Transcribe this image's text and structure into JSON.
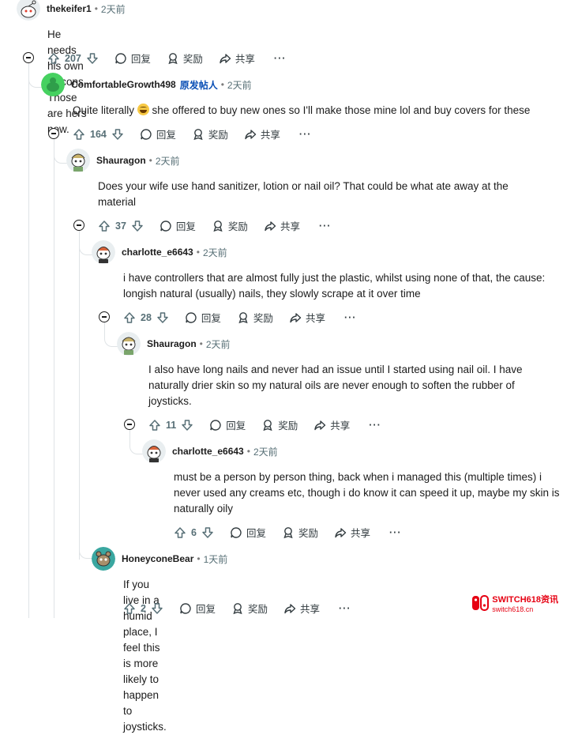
{
  "labels": {
    "reply": "回复",
    "award": "奖励",
    "share": "共享",
    "more": "···"
  },
  "comments": [
    {
      "id": "c1",
      "username": "thekeifer1",
      "time": "2天前",
      "op_badge": "",
      "body": "He needs his own joycons. Those are hers now.",
      "votes": "207",
      "avatar_icon": "snoo-avatar-icon"
    },
    {
      "id": "c2",
      "username": "ComfortableGrowth498",
      "time": "2天前",
      "op_badge": "原发帖人",
      "body_before": "Quite literally ",
      "emoji": "grinning-sweat-emoji",
      "body_after": " she offered to buy new ones so I'll make those mine lol and buy covers for these",
      "votes": "164",
      "avatar_icon": "green-default-avatar-icon"
    },
    {
      "id": "c3",
      "username": "Shauragon",
      "time": "2天前",
      "op_badge": "",
      "body": "Does your wife use hand sanitizer, lotion or nail oil? That could be what ate away at the material",
      "votes": "37",
      "avatar_icon": "snoo-avatar-icon"
    },
    {
      "id": "c4",
      "username": "charlotte_e6643",
      "time": "2天前",
      "op_badge": "",
      "body": "i have controllers that are almost fully just the plastic, whilst using none of that, the cause: longish natural (usually) nails, they slowly scrape at it over time",
      "votes": "28",
      "avatar_icon": "snoo-avatar-icon"
    },
    {
      "id": "c5",
      "username": "Shauragon",
      "time": "2天前",
      "op_badge": "",
      "body": "I also have long nails and never had an issue until I started using nail oil. I have naturally drier skin so my natural oils are never enough to soften the rubber of joysticks.",
      "votes": "11",
      "avatar_icon": "snoo-avatar-icon"
    },
    {
      "id": "c6",
      "username": "charlotte_e6643",
      "time": "2天前",
      "op_badge": "",
      "body": "must be a person by person thing, back when i managed this (multiple times) i never used any creams etc, though i do know it can speed it up, maybe my skin is naturally oily",
      "votes": "6",
      "avatar_icon": "snoo-avatar-icon"
    },
    {
      "id": "c7",
      "username": "HoneyconeBear",
      "time": "1天前",
      "op_badge": "",
      "body": "If you live in a humid place, I feel this is more likely to happen to joysticks.",
      "votes": "2",
      "avatar_icon": "teal-snoo-avatar-icon"
    }
  ],
  "watermark": {
    "brand": "SWITCH618资讯",
    "url": "switch618.cn",
    "icon": "switch-console-icon"
  },
  "colors": {
    "thread_line": "#dfe3e6",
    "op_badge": "#0a4fb5",
    "meta": "#576f76",
    "watermark": "#e60012"
  }
}
